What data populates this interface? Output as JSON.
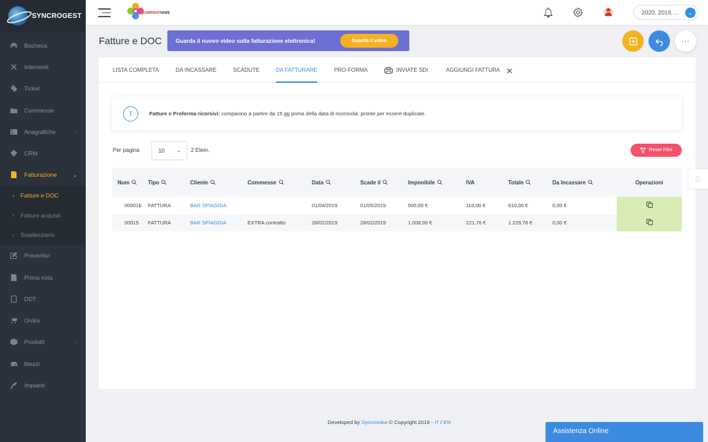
{
  "brand": {
    "name": "SYNCROGEST"
  },
  "sidebar": {
    "items": [
      {
        "label": "Bacheca",
        "icon": "dashboard-icon"
      },
      {
        "label": "Interventi",
        "icon": "tools-icon"
      },
      {
        "label": "Ticket",
        "icon": "ticket-icon"
      },
      {
        "label": "Commesse",
        "icon": "folder-icon"
      },
      {
        "label": "Anagrafiche",
        "icon": "contacts-icon",
        "chevron": "›"
      },
      {
        "label": "CRM",
        "icon": "crm-icon"
      },
      {
        "label": "Fatturazione",
        "icon": "invoice-icon",
        "chevron": "⌄"
      },
      {
        "label": "Preventivi",
        "icon": "edit-icon"
      },
      {
        "label": "Prima nota",
        "icon": "note-icon"
      },
      {
        "label": "DDT",
        "icon": "ddt-icon"
      },
      {
        "label": "Ordini",
        "icon": "cart-icon"
      },
      {
        "label": "Prodotti",
        "icon": "box-icon",
        "chevron": "›"
      },
      {
        "label": "Mezzi",
        "icon": "car-icon"
      },
      {
        "label": "Impianti",
        "icon": "plant-icon"
      }
    ],
    "submenu": [
      {
        "label": "Fatture e DOC"
      },
      {
        "label": "Fatture acquisti"
      },
      {
        "label": "Scadenziario"
      }
    ],
    "arrow": "›"
  },
  "topbar": {
    "company": {
      "line1": "COMPANY",
      "line2": "NAME"
    },
    "year_select": "2020, 2019, ...",
    "dropdown_glyph": "⌄"
  },
  "page": {
    "title": "Fatture e DOC",
    "banner_text": "Guarda il nuovo video sulla fatturazione elettronica!",
    "banner_button": "Guarda il video",
    "more_glyph": "···"
  },
  "tabs": [
    {
      "label": "LISTA COMPLETA"
    },
    {
      "label": "DA INCASSARE"
    },
    {
      "label": "SCADUTE"
    },
    {
      "label": "DA FATTURARE",
      "active": true
    },
    {
      "label": "PRO-FORMA"
    },
    {
      "label": "INVIATE SDI"
    },
    {
      "label": "AGGIUNGI FATTURA"
    }
  ],
  "tab_close": "✕",
  "alert": {
    "icon_glyph": "!",
    "bold": "Fatture e Proforma ricorsivi:",
    "text": " compaiono a partire da 15 gg prima della data di ricorsività, pronte per essere duplicate."
  },
  "list": {
    "per_page_label": "Per pagina",
    "per_page_value": "10",
    "chevron": "⌄",
    "count": "2 Elem.",
    "reset_label": "Reset Filtri"
  },
  "table": {
    "headers": [
      "Num",
      "Tipo",
      "Cliente",
      "Commesse",
      "Data",
      "Scade il",
      "Imponibile",
      "IVA",
      "Totale",
      "Da Incassare",
      "Operazioni"
    ],
    "rows": [
      [
        "00001b",
        "FATTURA",
        "BAR SPIAGGIA",
        "",
        "01/04/2019",
        "01/05/2019",
        "500,00 €",
        "110,00 €",
        "610,00 €",
        "0,00 €"
      ],
      [
        "00015",
        "FATTURA",
        "BAR SPIAGGIA",
        "EXTRA contratto",
        "28/02/2019",
        "28/02/2019",
        "1.008,00 €",
        "221,76 €",
        "1.229,76 €",
        "0,00 €"
      ]
    ]
  },
  "footer": {
    "prefix": "Developed by ",
    "link": "Syncronika",
    "copyright": " © Copyright 2019 - ",
    "lang_it": "IT",
    "sep": " / ",
    "lang_en": "EN"
  },
  "side_info_glyph": "ⓘ",
  "assistance": "Assistenza Online",
  "colors": {
    "accent": "#f4b223",
    "primary": "#3b8fd9",
    "danger": "#f4516c",
    "banner": "#6c6fd3",
    "ops": "#d8ecb3"
  }
}
